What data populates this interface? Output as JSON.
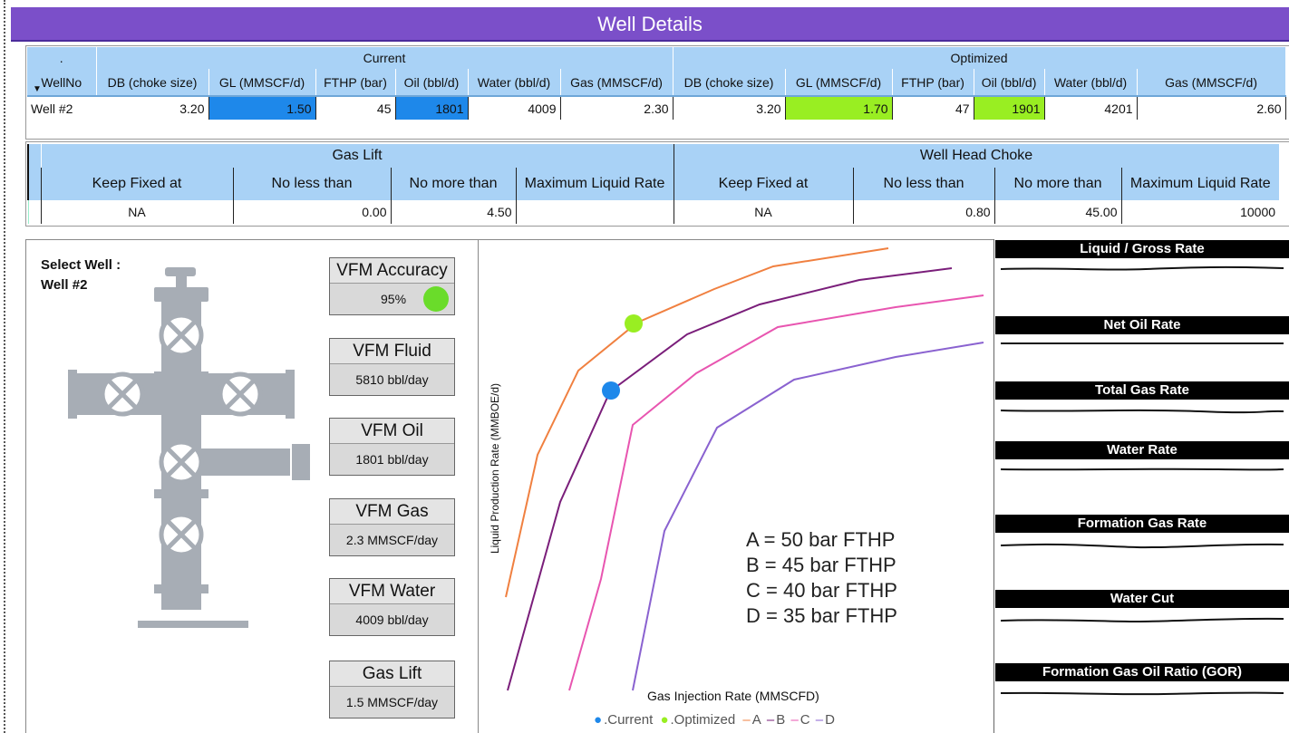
{
  "title": "Well Details",
  "well_table": {
    "group_corner": ".",
    "group_current": "Current",
    "group_optimized": "Optimized",
    "headers": [
      "WellNo",
      "DB (choke size)",
      "GL (MMSCF/d)",
      "FTHP (bar)",
      "Oil (bbl/d)",
      "Water (bbl/d)",
      "Gas (MMSCF/d)",
      "DB (choke size)",
      "GL (MMSCF/d)",
      "FTHP (bar)",
      "Oil (bbl/d)",
      "Water (bbl/d)",
      "Gas (MMSCF/d)"
    ],
    "row": [
      "Well #2",
      "3.20",
      "1.50",
      "45",
      "1801",
      "4009",
      "2.30",
      "3.20",
      "1.70",
      "47",
      "1901",
      "4201",
      "2.60"
    ]
  },
  "constraints_table": {
    "group_gas_lift": "Gas Lift",
    "group_choke": "Well Head Choke",
    "headers": [
      "Keep Fixed at",
      "No less than",
      "No more than",
      "Maximum Liquid Rate",
      "Keep Fixed at",
      "No less than",
      "No more than",
      "Maximum Liquid Rate"
    ],
    "row": [
      "NA",
      "0.00",
      "4.50",
      "",
      "NA",
      "0.80",
      "45.00",
      "10000"
    ]
  },
  "select_well": {
    "label": "Select Well :",
    "value": "Well #2"
  },
  "vfm": [
    {
      "title": "VFM Accuracy",
      "value": "95%"
    },
    {
      "title": "VFM Fluid",
      "value": "5810 bbl/day"
    },
    {
      "title": "VFM Oil",
      "value": "1801 bbl/day"
    },
    {
      "title": "VFM Gas",
      "value": "2.3 MMSCF/day"
    },
    {
      "title": "VFM Water",
      "value": "4009 bbl/day"
    },
    {
      "title": "Gas Lift",
      "value": "1.5 MMSCF/day"
    }
  ],
  "chart": {
    "xlabel": "Gas Injection Rate (MMSCFD)",
    "ylabel": "Liquid Production Rate (MMBOE/d)",
    "annotations": [
      "A = 50 bar FTHP",
      "B = 45 bar FTHP",
      "C = 40 bar FTHP",
      "D = 35 bar FTHP"
    ],
    "legend": [
      "Current",
      "Optimized",
      "A",
      "B",
      "C",
      "D"
    ],
    "colors": {
      "A": "#f08040",
      "B": "#7a1e7a",
      "C": "#e855b0",
      "D": "#8a62d0",
      "current": "#1e88ea",
      "optimized": "#99ee22"
    }
  },
  "rate_panels": [
    "Liquid / Gross Rate",
    "Net Oil Rate",
    "Total Gas Rate",
    "Water Rate",
    "Formation Gas Rate",
    "Water Cut",
    "Formation Gas Oil Ratio (GOR)"
  ]
}
